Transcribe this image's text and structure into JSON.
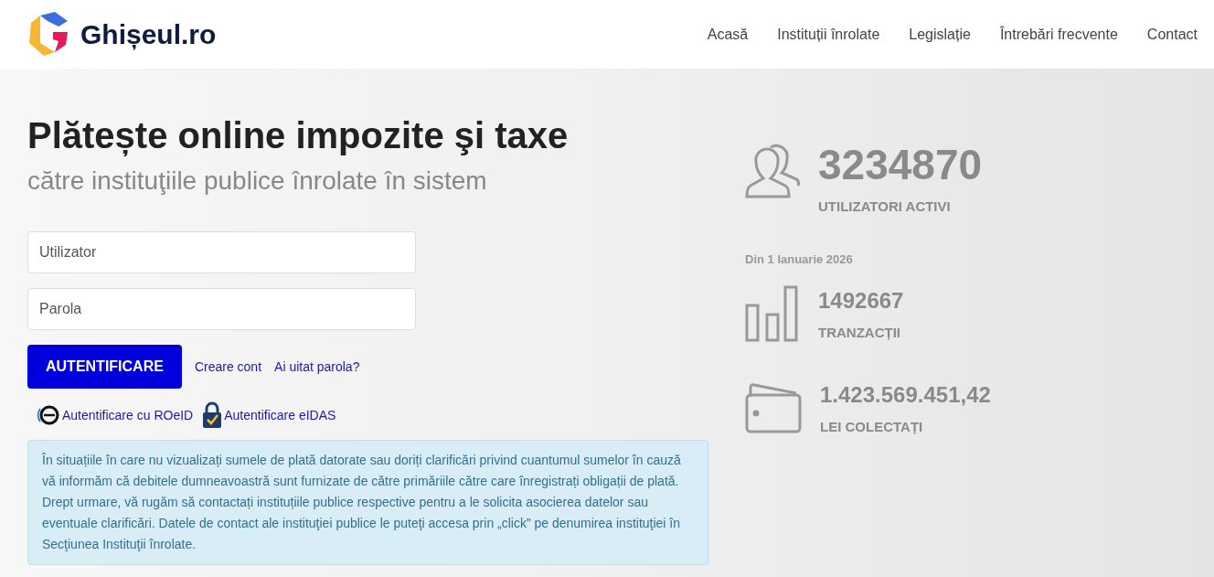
{
  "header": {
    "logo_text": "Ghișeul.ro",
    "nav": [
      {
        "label": "Acasă"
      },
      {
        "label": "Instituții înrolate"
      },
      {
        "label": "Legislație"
      },
      {
        "label": "Întrebări frecvente"
      },
      {
        "label": "Contact"
      }
    ]
  },
  "hero": {
    "title": "Plătește online impozite şi taxe",
    "subtitle": "către instituţiile publice înrolate în sistem"
  },
  "login": {
    "username": {
      "placeholder": "Utilizator"
    },
    "password": {
      "placeholder": "Parola"
    },
    "submit": "AUTENTIFICARE",
    "links": [
      "Creare cont",
      "Ai uitat parola?"
    ],
    "alt_logins": [
      {
        "kind": "roeid",
        "label": "Autentificare cu ROeID"
      },
      {
        "kind": "eidas",
        "label": "Autentificare eIDAS"
      }
    ]
  },
  "notice": "În situațiile în care nu vizualizați sumele de plată datorate sau doriți clarificări privind cuantumul sumelor în cauză vă informăm că debitele dumneavoastră sunt furnizate de către primăriile către care înregistrați obligații de plată. Drept urmare, vă rugăm să contactați instituțiile publice respective pentru a le solicita asocierea datelor sau eventuale clarificări. Datele de contact ale instituţiei publice le puteţi accesa prin „click” pe denumirea instituţiei în Secţiunea Instituţii înrolate.",
  "stats": {
    "users": {
      "value": "3234870",
      "label": "UTILIZATORI ACTIVI"
    },
    "since": "Din 1 Ianuarie 2026",
    "items": [
      {
        "kind": "chart",
        "value": "1492667",
        "label": "TRANZACȚII"
      },
      {
        "kind": "wallet",
        "value": "1.423.569.451,42",
        "label": "LEI COLECTAȚI"
      }
    ]
  }
}
